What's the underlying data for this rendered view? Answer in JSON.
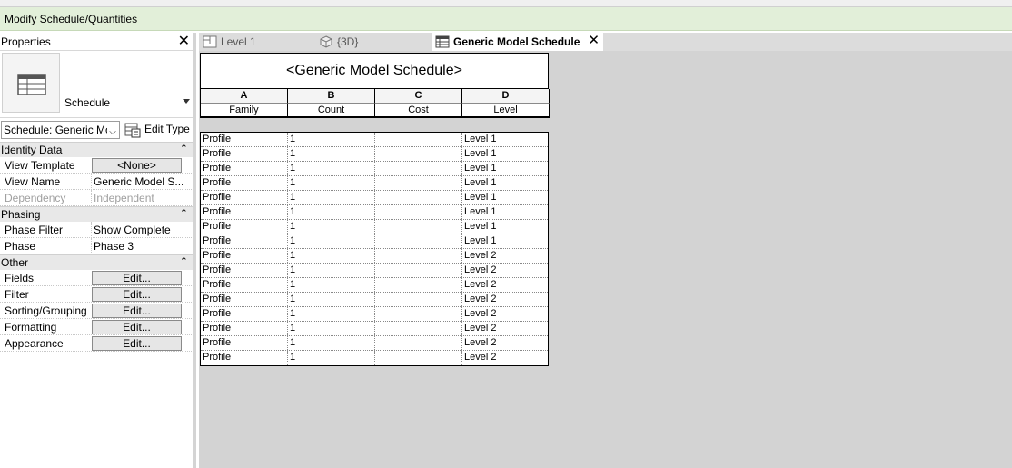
{
  "context_tab": "Modify Schedule/Quantities",
  "properties": {
    "title": "Properties",
    "type_name": "Schedule",
    "instance_select": "Schedule: Generic Mo",
    "edit_type": "Edit Type",
    "groups": [
      {
        "label": "Identity Data",
        "rows": [
          {
            "name": "View Template",
            "value": "<None>",
            "button": true
          },
          {
            "name": "View Name",
            "value": "Generic Model S...",
            "button": false
          },
          {
            "name": "Dependency",
            "value": "Independent",
            "button": false,
            "dim": true
          }
        ]
      },
      {
        "label": "Phasing",
        "rows": [
          {
            "name": "Phase Filter",
            "value": "Show Complete",
            "button": false
          },
          {
            "name": "Phase",
            "value": "Phase 3",
            "button": false
          }
        ]
      },
      {
        "label": "Other",
        "rows": [
          {
            "name": "Fields",
            "value": "Edit...",
            "button": true
          },
          {
            "name": "Filter",
            "value": "Edit...",
            "button": true
          },
          {
            "name": "Sorting/Grouping",
            "value": "Edit...",
            "button": true
          },
          {
            "name": "Formatting",
            "value": "Edit...",
            "button": true
          },
          {
            "name": "Appearance",
            "value": "Edit...",
            "button": true
          }
        ]
      }
    ]
  },
  "tabs": [
    {
      "label": "Level 1",
      "icon": "floor-plan-icon",
      "active": false
    },
    {
      "label": "{3D}",
      "icon": "3d-view-icon",
      "active": false
    },
    {
      "label": "Generic Model Schedule",
      "icon": "schedule-icon",
      "active": true
    }
  ],
  "schedule": {
    "title": "<Generic Model Schedule>",
    "column_letters": [
      "A",
      "B",
      "C",
      "D"
    ],
    "column_headers": [
      "Family",
      "Count",
      "Cost",
      "Level"
    ],
    "rows": [
      [
        "Profile",
        "1",
        "",
        "Level 1"
      ],
      [
        "Profile",
        "1",
        "",
        "Level 1"
      ],
      [
        "Profile",
        "1",
        "",
        "Level 1"
      ],
      [
        "Profile",
        "1",
        "",
        "Level 1"
      ],
      [
        "Profile",
        "1",
        "",
        "Level 1"
      ],
      [
        "Profile",
        "1",
        "",
        "Level 1"
      ],
      [
        "Profile",
        "1",
        "",
        "Level 1"
      ],
      [
        "Profile",
        "1",
        "",
        "Level 1"
      ],
      [
        "Profile",
        "1",
        "",
        "Level 2"
      ],
      [
        "Profile",
        "1",
        "",
        "Level 2"
      ],
      [
        "Profile",
        "1",
        "",
        "Level 2"
      ],
      [
        "Profile",
        "1",
        "",
        "Level 2"
      ],
      [
        "Profile",
        "1",
        "",
        "Level 2"
      ],
      [
        "Profile",
        "1",
        "",
        "Level 2"
      ],
      [
        "Profile",
        "1",
        "",
        "Level 2"
      ],
      [
        "Profile",
        "1",
        "",
        "Level 2"
      ]
    ]
  },
  "colors": {
    "context_bar": "#e2efd9",
    "canvas": "#d3d3d3",
    "tab_strip": "#dcdcdc"
  }
}
